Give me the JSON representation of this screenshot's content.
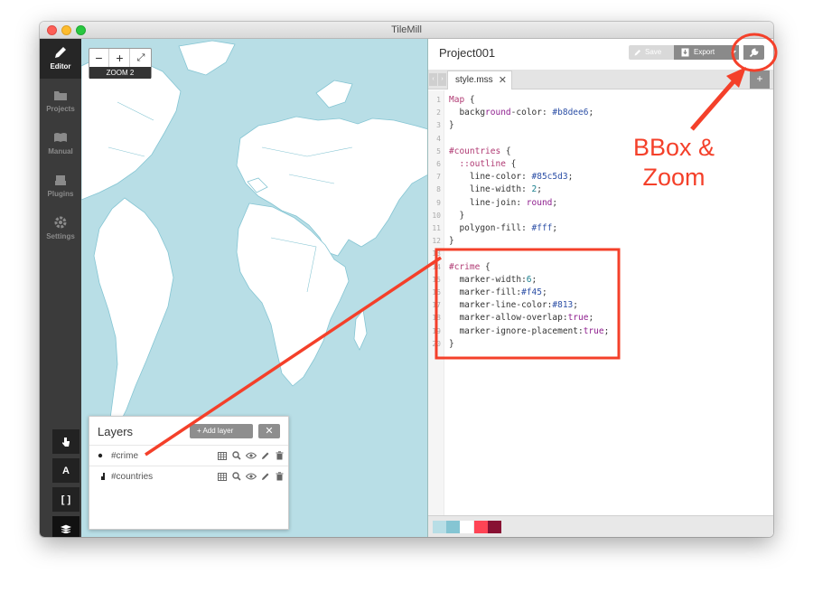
{
  "window": {
    "title": "TileMill"
  },
  "sidebar": {
    "items": [
      {
        "label": "Editor",
        "icon": "pencil-icon",
        "active": true
      },
      {
        "label": "Projects",
        "icon": "folder-icon",
        "active": false
      },
      {
        "label": "Manual",
        "icon": "book-icon",
        "active": false
      },
      {
        "label": "Plugins",
        "icon": "plugin-icon",
        "active": false
      },
      {
        "label": "Settings",
        "icon": "gear-icon",
        "active": false
      }
    ],
    "tools": [
      {
        "label": "",
        "icon": "hand-pointer-icon"
      },
      {
        "label": "A",
        "icon": "font-icon"
      },
      {
        "label": "[ ]",
        "icon": "brackets-icon"
      },
      {
        "label": "",
        "icon": "layers-icon"
      }
    ]
  },
  "map": {
    "zoom_in": "+",
    "zoom_out": "−",
    "fullscreen": "⤢",
    "zoom_label": "ZOOM 2"
  },
  "layers": {
    "title": "Layers",
    "add_label": "Add layer",
    "close_label": "✕",
    "items": [
      {
        "name": "#crime",
        "icon": "point-icon"
      },
      {
        "name": "#countries",
        "icon": "polygon-icon"
      }
    ]
  },
  "editor": {
    "project_title": "Project001",
    "save_label": "Save",
    "export_label": "Export",
    "tab_label": "style.mss",
    "tab_close": "✕",
    "tab_add": "+",
    "code": [
      {
        "n": "1",
        "text": "Map {"
      },
      {
        "n": "2",
        "text": "  background-color: #b8dee6;"
      },
      {
        "n": "3",
        "text": "}"
      },
      {
        "n": "4",
        "text": ""
      },
      {
        "n": "5",
        "text": "#countries {"
      },
      {
        "n": "6",
        "text": "  ::outline {"
      },
      {
        "n": "7",
        "text": "    line-color: #85c5d3;"
      },
      {
        "n": "8",
        "text": "    line-width: 2;"
      },
      {
        "n": "9",
        "text": "    line-join: round;"
      },
      {
        "n": "10",
        "text": "  }"
      },
      {
        "n": "11",
        "text": "  polygon-fill: #fff;"
      },
      {
        "n": "12",
        "text": "}"
      },
      {
        "n": "13",
        "text": ""
      },
      {
        "n": "14",
        "text": "#crime {"
      },
      {
        "n": "15",
        "text": "  marker-width:6;"
      },
      {
        "n": "16",
        "text": "  marker-fill:#f45;"
      },
      {
        "n": "17",
        "text": "  marker-line-color:#813;"
      },
      {
        "n": "18",
        "text": "  marker-allow-overlap:true;"
      },
      {
        "n": "19",
        "text": "  marker-ignore-placement:true;"
      },
      {
        "n": "20",
        "text": "}"
      }
    ],
    "palette": [
      "#b8dee6",
      "#85c5d3",
      "#ffffff",
      "#ff4455",
      "#881133"
    ]
  },
  "annotation": {
    "line1": "BBox &",
    "line2": "Zoom",
    "color": "#f4402a"
  },
  "colors": {
    "map_water": "#b8dee6",
    "country_outline": "#85c5d3",
    "land": "#ffffff",
    "sidebar": "#3b3b3b"
  }
}
